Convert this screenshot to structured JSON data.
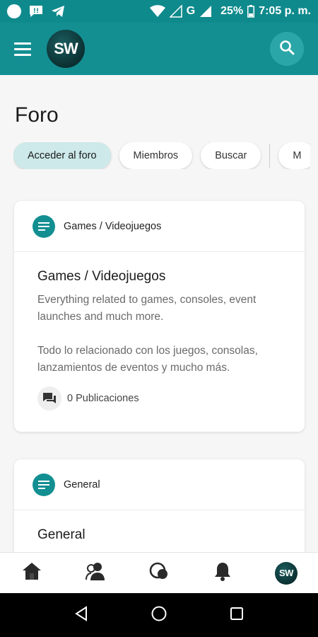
{
  "status_bar": {
    "battery": "25%",
    "time": "7:05 p. m.",
    "network": "G"
  },
  "header": {
    "logo_text": "SW"
  },
  "page": {
    "title": "Foro"
  },
  "tabs": [
    {
      "label": "Acceder al foro",
      "active": true
    },
    {
      "label": "Miembros",
      "active": false
    },
    {
      "label": "Buscar",
      "active": false
    },
    {
      "label": "M",
      "active": false
    }
  ],
  "categories": [
    {
      "header_name": "Games / Videojuegos",
      "title": "Games / Videojuegos",
      "description_en": "Everything related to games, consoles, event launches and much more.",
      "description_es": "Todo lo relacionado con los juegos, consolas, lanzamientos de eventos y mucho más.",
      "posts": "0 Publicaciones"
    },
    {
      "header_name": "General",
      "title": "General"
    }
  ],
  "bottom_nav": {
    "avatar_text": "SW"
  },
  "colors": {
    "primary": "#138f92",
    "status_bar": "#0f8a8c",
    "active_chip": "#cde9ea"
  }
}
